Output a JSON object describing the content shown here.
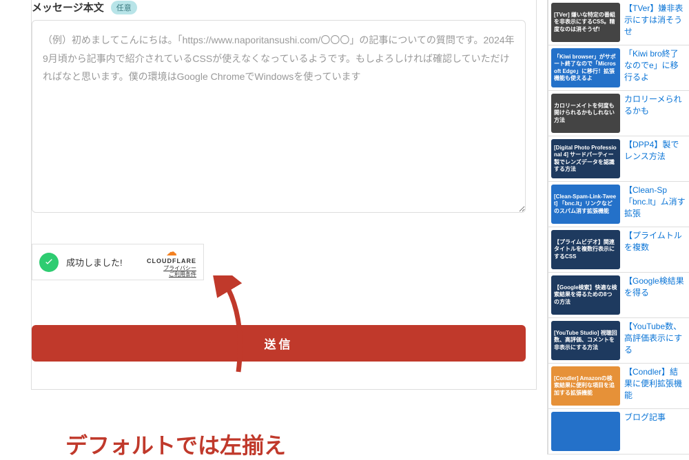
{
  "form": {
    "label": "メッセージ本文",
    "badge_optional": "任意",
    "placeholder": "（例）初めましてこんにちは。「https://www.naporitansushi.com/〇〇〇」の記事についての質問です。2024年9月頃から記事内で紹介されているCSSが使えなくなっているようです。もしよろしければ確認していただければなと思います。僕の環境はGoogle ChromeでWindowsを使っています",
    "cloudflare": {
      "success_text": "成功しました!",
      "logo": "CLOUDFLARE",
      "privacy": "プライバシー",
      "terms": "ご利用条件"
    },
    "submit_label": "送信"
  },
  "annotation": "デフォルトでは左揃え",
  "sidebar": {
    "items": [
      {
        "thumb_text": "[TVer] 嫌いな特定の番組を非表示にするCSS。精度なのは消そうぜ!",
        "bg": "bg-photo",
        "link": "【TVer】嫌非表示にすは消そうせ"
      },
      {
        "thumb_text": "「Kiwi browser」がサポート終了なので「Microsoft Edge」に移行！拡張機能も使えるよ",
        "bg": "bg-blue",
        "link": "「Kiwi bro終了なのでe」に移行るよ"
      },
      {
        "thumb_text": "カロリーメイトを何度も開けられるかもしれない方法",
        "bg": "bg-photo",
        "link": "カロリーメられるかも"
      },
      {
        "thumb_text": "[Digital Photo Professional 4] サードパーティー製でレンズデータを認識する方法",
        "bg": "bg-navy",
        "link": "【DPP4】製でレンス方法"
      },
      {
        "thumb_text": "[Clean-Spam-Link-Tweet] 「bnc.lt」リンクなどのスパム消す拡張機能",
        "bg": "bg-blue",
        "link": "【Clean-Sp「bnc.lt」ム消す拡張"
      },
      {
        "thumb_text": "【プライムビデオ】関連タイトルを複数行表示にするCSS",
        "bg": "bg-navy",
        "link": "【プライムトルを複数"
      },
      {
        "thumb_text": "【Google検索】快適な検索結果を得るための8つの方法",
        "bg": "bg-navy",
        "link": "【Google検結果を得る"
      },
      {
        "thumb_text": "[YouTube Studio] 視聴回数、高評価、コメントを非表示にする方法",
        "bg": "bg-navy",
        "link": "【YouTube数、高評価表示にする"
      },
      {
        "thumb_text": "[Condler] Amazonの検索結果に便利な項目を追加する拡張機能",
        "bg": "bg-orange",
        "link": "【Condler】結果に便利拡張機能"
      },
      {
        "thumb_text": "",
        "bg": "bg-blue",
        "link": "ブログ記事"
      }
    ]
  }
}
